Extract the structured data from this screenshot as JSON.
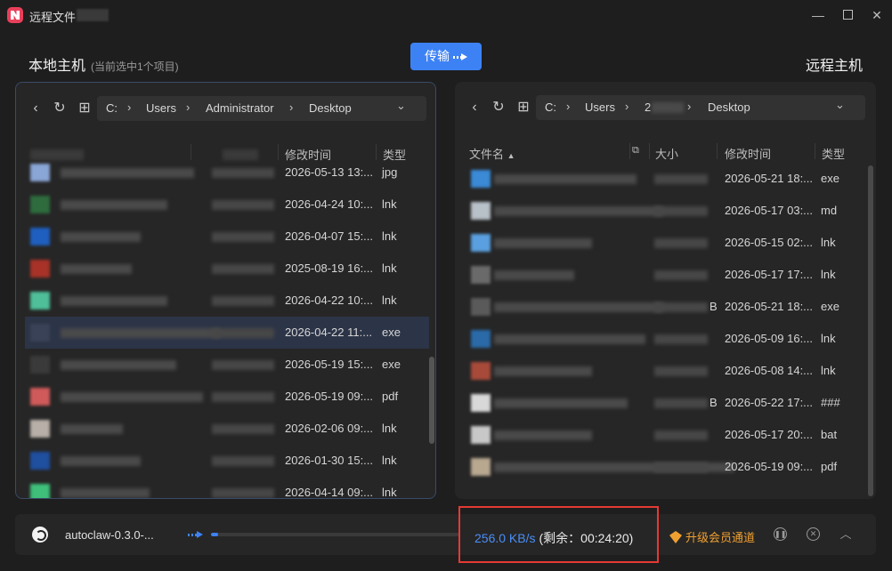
{
  "window": {
    "title": "远程文件",
    "min_icon": "minimize-icon",
    "max_icon": "maximize-icon",
    "close_icon": "close-icon"
  },
  "header": {
    "local_title": "本地主机",
    "local_sub": "(当前选中1个项目)",
    "remote_title": "远程主机",
    "transfer_label": "传输"
  },
  "local": {
    "crumbs": [
      "C:",
      "Users",
      "Administrator",
      "Desktop"
    ],
    "columns": {
      "size": "大小",
      "mtime": "修改时间",
      "type": "类型"
    },
    "rows": [
      {
        "time": "2026-05-13 13:...",
        "type": "jpg",
        "icon_color": "#8aa6d6"
      },
      {
        "time": "2026-04-24 10:...",
        "type": "lnk",
        "icon_color": "#2e6b3d"
      },
      {
        "time": "2026-04-07 15:...",
        "type": "lnk",
        "icon_color": "#1f5fbf"
      },
      {
        "time": "2025-08-19 16:...",
        "type": "lnk",
        "icon_color": "#a83228"
      },
      {
        "time": "2026-04-22 10:...",
        "type": "lnk",
        "icon_color": "#4fbf9a"
      },
      {
        "time": "2026-04-22 11:...",
        "type": "exe",
        "icon_color": "#3a4257",
        "selected": true
      },
      {
        "time": "2026-05-19 15:...",
        "type": "exe",
        "icon_color": "#3a3a3a"
      },
      {
        "time": "2026-05-19 09:...",
        "type": "pdf",
        "icon_color": "#d05a5a"
      },
      {
        "time": "2026-02-06 09:...",
        "type": "lnk",
        "icon_color": "#b8b0a8"
      },
      {
        "time": "2026-01-30 15:...",
        "type": "lnk",
        "icon_color": "#1f4f9f"
      },
      {
        "time": "2026-04-14 09:...",
        "type": "lnk",
        "icon_color": "#3fbf7a"
      }
    ]
  },
  "remote": {
    "crumbs": [
      "C:",
      "Users",
      "2",
      "Desktop"
    ],
    "columns": {
      "name": "文件名",
      "size": "大小",
      "mtime": "修改时间",
      "type": "类型"
    },
    "rows": [
      {
        "time": "2026-05-21 18:...",
        "type": "exe",
        "icon_color": "#3a8ad6"
      },
      {
        "time": "2026-05-17 03:...",
        "type": "md",
        "icon_color": "#b8c0c8"
      },
      {
        "time": "2026-05-15 02:...",
        "type": "lnk",
        "icon_color": "#5aa0e0"
      },
      {
        "time": "2026-05-17 17:...",
        "type": "lnk",
        "icon_color": "#6a6a6a"
      },
      {
        "time": "2026-05-21 18:...",
        "type": "exe",
        "icon_color": "#5a5a5a",
        "size_tail": "B"
      },
      {
        "time": "2026-05-09 16:...",
        "type": "lnk",
        "icon_color": "#2a6aa8"
      },
      {
        "time": "2026-05-08 14:...",
        "type": "lnk",
        "icon_color": "#a84a3a"
      },
      {
        "time": "2026-05-22 17:...",
        "type": "###",
        "icon_color": "#d8d8d8",
        "size_tail": "B"
      },
      {
        "time": "2026-05-17 20:...",
        "type": "bat",
        "icon_color": "#c8c8c8"
      },
      {
        "time": "2026-05-19 09:...",
        "type": "pdf",
        "icon_color": "#b8a890"
      }
    ]
  },
  "transfer": {
    "file_name": "autoclaw-0.3.0-...",
    "speed": "256.0 KB/s",
    "remaining": "(剩余：00:24:20)",
    "vip_label": "升级会员通道",
    "progress": 0.03
  }
}
